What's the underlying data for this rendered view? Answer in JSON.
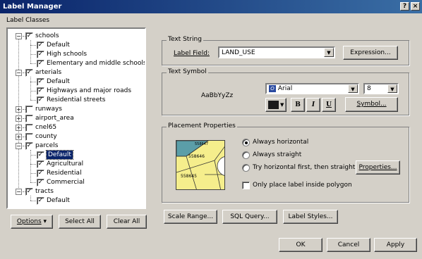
{
  "window": {
    "title": "Label Manager",
    "help_btn": "?",
    "close_btn": "×"
  },
  "label_classes": {
    "heading": "Label Classes",
    "tree": [
      {
        "label": "schools",
        "checked": true,
        "level": 0,
        "expander": "−"
      },
      {
        "label": "Default",
        "checked": true,
        "level": 1
      },
      {
        "label": "High schools",
        "checked": true,
        "level": 1
      },
      {
        "label": "Elementary and middle schools",
        "checked": true,
        "level": 1
      },
      {
        "label": "arterials",
        "checked": true,
        "level": 0,
        "expander": "−"
      },
      {
        "label": "Default",
        "checked": true,
        "level": 1
      },
      {
        "label": "Highways and major roads",
        "checked": true,
        "level": 1
      },
      {
        "label": "Residential streets",
        "checked": true,
        "level": 1
      },
      {
        "label": "runways",
        "checked": false,
        "level": 0,
        "expander": "+"
      },
      {
        "label": "airport_area",
        "checked": false,
        "level": 0,
        "expander": "+"
      },
      {
        "label": "cnel65",
        "checked": false,
        "level": 0,
        "expander": "+"
      },
      {
        "label": "county",
        "checked": false,
        "level": 0,
        "expander": "+"
      },
      {
        "label": "parcels",
        "checked": true,
        "level": 0,
        "expander": "−"
      },
      {
        "label": "Default",
        "checked": true,
        "level": 1,
        "selected": true
      },
      {
        "label": "Agricultural",
        "checked": true,
        "level": 1
      },
      {
        "label": "Residential",
        "checked": true,
        "level": 1
      },
      {
        "label": "Commercial",
        "checked": true,
        "level": 1
      },
      {
        "label": "tracts",
        "checked": true,
        "level": 0,
        "expander": "−"
      },
      {
        "label": "Default",
        "checked": true,
        "level": 1
      }
    ],
    "check_glyph": "✓",
    "options_button": "Options",
    "options_arrow": "▾",
    "select_all_button": "Select All",
    "clear_all_button": "Clear All"
  },
  "text_string": {
    "title": "Text String",
    "label_field_label": "Label Field:",
    "label_field_value": "LAND_USE",
    "expression_button": "Expression..."
  },
  "text_symbol": {
    "title": "Text Symbol",
    "preview_text": "AaBbYyZz",
    "font_value": "Arial",
    "font_icon_glyph": "O",
    "size_value": "8",
    "bold_label": "B",
    "italic_label": "I",
    "underline_label": "U",
    "symbol_button": "Symbol...",
    "color": "#1a1a1a"
  },
  "placement": {
    "title": "Placement Properties",
    "options": [
      {
        "label": "Always horizontal",
        "selected": true
      },
      {
        "label": "Always straight",
        "selected": false
      },
      {
        "label": "Try horizontal first, then straight",
        "selected": false
      }
    ],
    "properties_button": "Properties...",
    "inside_polygon_label": "Only place label inside polygon",
    "inside_polygon_checked": false,
    "preview_labels": [
      "558647",
      "558646",
      "558645"
    ]
  },
  "bottom_buttons": {
    "scale_range": "Scale Range...",
    "sql_query": "SQL Query...",
    "label_styles": "Label Styles...",
    "ok": "OK",
    "cancel": "Cancel",
    "apply": "Apply"
  },
  "colors": {
    "title_start": "#0a246a",
    "title_end": "#3a6ea5",
    "face": "#d4d0c8",
    "polygon_fill": "#f5ee8c",
    "water": "#5b9ea8"
  }
}
